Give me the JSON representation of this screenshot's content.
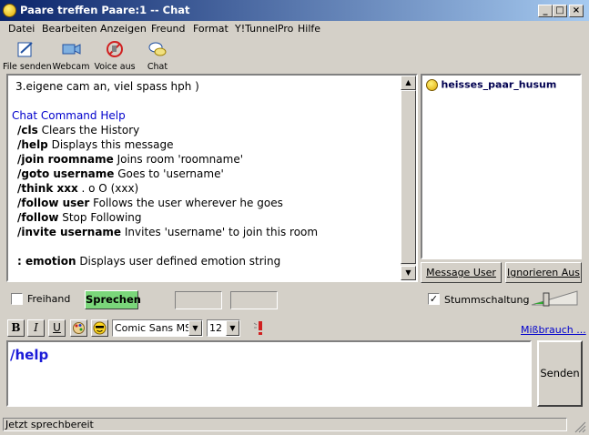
{
  "window": {
    "title": "Paare treffen Paare:1 -- Chat",
    "minimize": "_",
    "maximize": "□",
    "close": "×"
  },
  "menu": [
    "Datei",
    "Bearbeiten",
    "Anzeigen",
    "Freund",
    "Format",
    "Y!TunnelPro",
    "Hilfe"
  ],
  "toolbar": [
    {
      "label": "File senden",
      "icon": "file-send-icon"
    },
    {
      "label": "Webcam",
      "icon": "webcam-icon"
    },
    {
      "label": "Voice aus",
      "icon": "voice-off-icon"
    },
    {
      "label": "Chat",
      "icon": "chat-icon"
    }
  ],
  "chat": {
    "lines": [
      {
        "cmd": "",
        "text": "3.eigene cam an, viel spass hph )",
        "type": "plain"
      },
      {
        "cmd": "",
        "text": "",
        "type": "blank"
      },
      {
        "cmd": "",
        "text": "Chat Command Help",
        "type": "heading"
      },
      {
        "cmd": "/cls",
        "text": " Clears the History",
        "type": "cmd"
      },
      {
        "cmd": "/help",
        "text": " Displays this message",
        "type": "cmd"
      },
      {
        "cmd": "/join roomname",
        "text": " Joins room 'roomname'",
        "type": "cmd"
      },
      {
        "cmd": "/goto username",
        "text": " Goes to 'username'",
        "type": "cmd"
      },
      {
        "cmd": "/think xxx",
        "text": " . o O (xxx)",
        "type": "cmd"
      },
      {
        "cmd": "/follow user",
        "text": " Follows the user wherever he goes",
        "type": "cmd"
      },
      {
        "cmd": "/follow",
        "text": " Stop Following",
        "type": "cmd"
      },
      {
        "cmd": "/invite username",
        "text": " Invites 'username' to join this room",
        "type": "cmd"
      },
      {
        "cmd": "",
        "text": "",
        "type": "blank"
      },
      {
        "cmd": ": emotion",
        "text": " Displays user defined emotion string",
        "type": "cmd"
      }
    ]
  },
  "users": [
    {
      "name": "heisses_paar_husum",
      "icon": "smiley-icon"
    }
  ],
  "buttons": {
    "message_user": "Message User",
    "ignore": "Ignorieren Aus",
    "freihand": "Freihand",
    "sprechen": "Sprechen",
    "mute": "Stummschaltung",
    "mute_checked": "✓",
    "senden": "Senden",
    "abuse": "Mißbrauch ..."
  },
  "format": {
    "bold": "B",
    "italic": "I",
    "underline": "U",
    "font": "Comic Sans MS",
    "size": "12"
  },
  "input": {
    "value": "/help"
  },
  "status": {
    "text": "Jetzt sprechbereit"
  },
  "colors": {
    "titlebar_start": "#0a246a",
    "heading": "#0000cc",
    "sprechen_bg": "#7ad67a",
    "abuse_link": "#0000cc"
  }
}
